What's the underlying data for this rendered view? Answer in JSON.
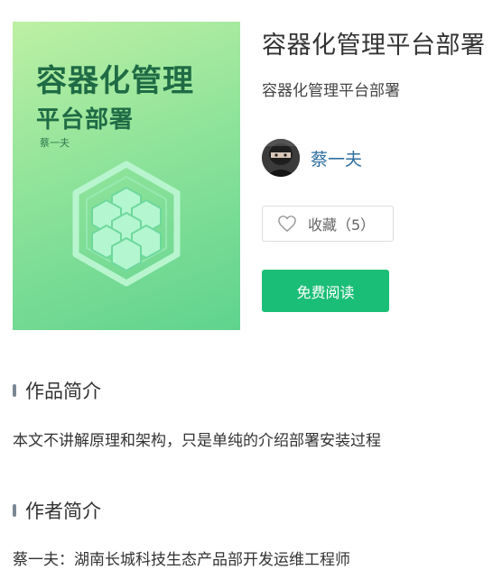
{
  "cover": {
    "title_line1": "容器化管理",
    "title_line2": "平台部署",
    "author": "蔡一夫"
  },
  "book": {
    "title": "容器化管理平台部署",
    "subtitle": "容器化管理平台部署"
  },
  "author": {
    "name": "蔡一夫"
  },
  "actions": {
    "favorite_label": "收藏（5）",
    "read_label": "免费阅读"
  },
  "sections": {
    "intro": {
      "title": "作品简介",
      "text": "本文不讲解原理和架构，只是单纯的介绍部署安装过程"
    },
    "author_intro": {
      "title": "作者简介",
      "text": "蔡一夫：湖南长城科技生态产品部开发运维工程师"
    }
  },
  "icons": {
    "favorite": "heart-outline-icon",
    "cover_logo": "hexagon-cubes-logo-icon"
  },
  "colors": {
    "accent_green": "#1bbe77",
    "author_link": "#2f6f9f",
    "cover_text": "#1f6b45"
  }
}
